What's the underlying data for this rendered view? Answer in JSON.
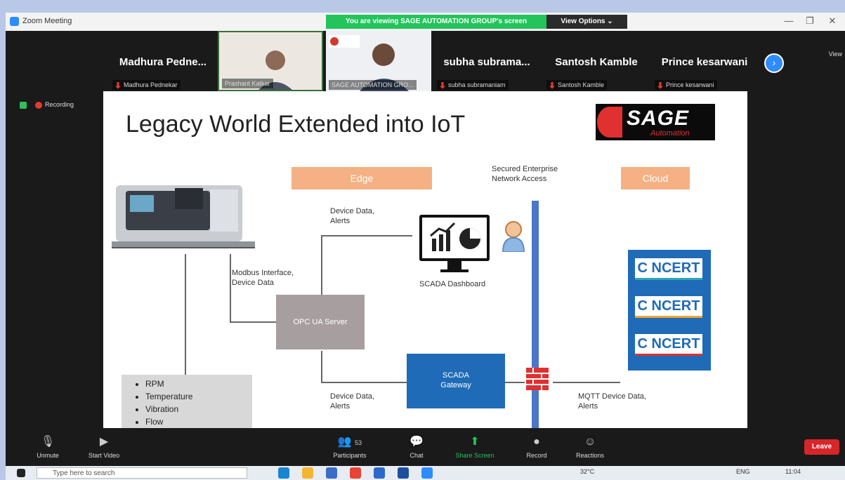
{
  "window": {
    "title": "Zoom Meeting",
    "viewing_banner": "You are viewing SAGE AUTOMATION GROUP's screen",
    "view_options": "View Options ⌄",
    "view_label": "View"
  },
  "participants": [
    {
      "display": "Madhura Pedne...",
      "name": "Madhura Pednekar"
    },
    {
      "display": "",
      "name": "Prashant Katkar"
    },
    {
      "display": "",
      "name": "SAGE AUTOMATION GRO..."
    },
    {
      "display": "subha subrama...",
      "name": "subha subramaniam"
    },
    {
      "display": "Santosh Kamble",
      "name": "Santosh Kamble"
    },
    {
      "display": "Prince kesarwani",
      "name": "Prince kesarwani"
    }
  ],
  "recording": "Recording",
  "slide": {
    "title": "Legacy World Extended into IoT",
    "logo_word": "SAGE",
    "logo_sub": "Automation",
    "edge": "Edge",
    "cloud": "Cloud",
    "secured": "Secured Enterprise\nNetwork Access",
    "device_alerts_top": "Device Data,\nAlerts",
    "modbus": "Modbus Interface,\nDevice Data",
    "scada_dashboard": "SCADA Dashboard",
    "opc": "OPC UA Server",
    "scada_gateway": "SCADA\nGateway",
    "device_alerts_bottom": "Device Data,\nAlerts",
    "mqtt": "MQTT Device Data,\nAlerts",
    "bullets": [
      "RPM",
      "Temperature",
      "Vibration",
      "Flow"
    ],
    "concert": [
      "C NCERT",
      "C NCERT",
      "C NCERT"
    ]
  },
  "toolbar": {
    "unmute": "Unmute",
    "start_video": "Start Video",
    "participants": "Participants",
    "participants_count": "53",
    "chat": "Chat",
    "share": "Share Screen",
    "record": "Record",
    "reactions": "Reactions",
    "leave": "Leave"
  },
  "taskbar": {
    "search_placeholder": "Type here to search",
    "temp": "32°C",
    "lang": "ENG",
    "time": "11:04"
  },
  "colors": {
    "accent": "#2d8cff",
    "green_banner": "#23c45b",
    "leave": "#d6262a",
    "edge_pill": "#f5b183",
    "gateway": "#1f6bb8"
  }
}
